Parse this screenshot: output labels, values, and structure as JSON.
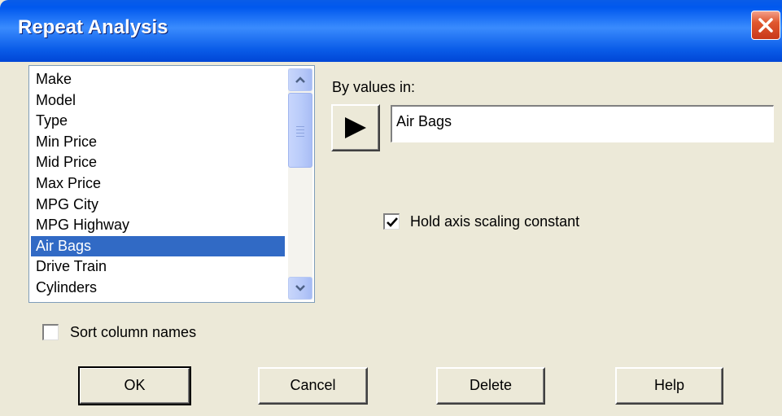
{
  "window": {
    "title": "Repeat Analysis",
    "close_icon": "close-x-icon"
  },
  "column_list": {
    "items": [
      "Make",
      "Model",
      "Type",
      "Min Price",
      "Mid Price",
      "Max Price",
      "MPG City",
      "MPG Highway",
      "Air Bags",
      "Drive Train",
      "Cylinders"
    ],
    "selected": "Air Bags"
  },
  "by_values": {
    "label": "By values in:",
    "value": "Air Bags",
    "add_icon": "right-arrow-icon"
  },
  "hold_axis": {
    "label": "Hold axis scaling constant",
    "checked": true
  },
  "sort_names": {
    "label": "Sort column names",
    "checked": false
  },
  "buttons": {
    "ok": "OK",
    "cancel": "Cancel",
    "delete": "Delete",
    "help": "Help"
  }
}
